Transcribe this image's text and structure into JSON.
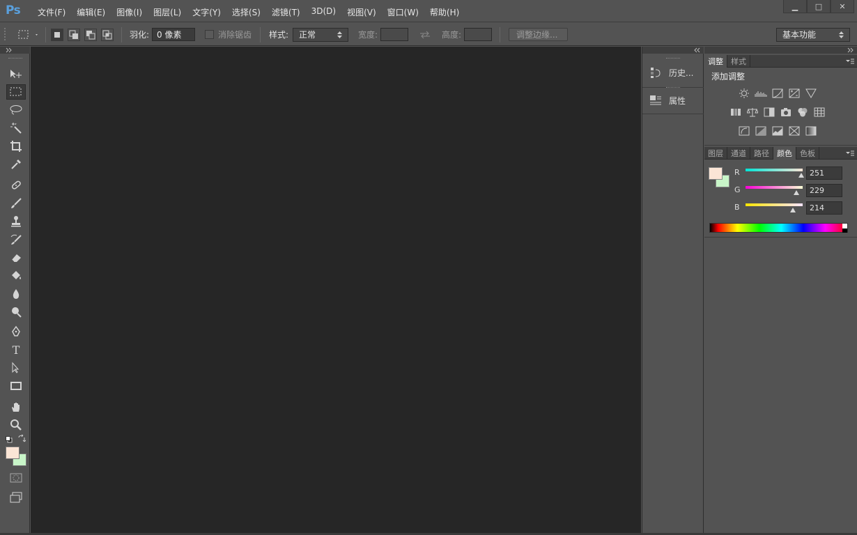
{
  "app": {
    "logo": "Ps"
  },
  "menubar": {
    "items": [
      "文件(F)",
      "编辑(E)",
      "图像(I)",
      "图层(L)",
      "文字(Y)",
      "选择(S)",
      "滤镜(T)",
      "3D(D)",
      "视图(V)",
      "窗口(W)",
      "帮助(H)"
    ]
  },
  "window_controls": {
    "minimize": "▁",
    "restore": "□",
    "close": "✕"
  },
  "options": {
    "feather_label": "羽化:",
    "feather_value": "0 像素",
    "antialias_label": "消除锯齿",
    "style_label": "样式:",
    "style_value": "正常",
    "width_label": "宽度:",
    "height_label": "高度:",
    "refine_edge_label": "调整边缘...",
    "workspace_value": "基本功能"
  },
  "middock": {
    "history_label": "历史...",
    "properties_label": "属性"
  },
  "adjustments": {
    "tabs": [
      "调整",
      "样式"
    ],
    "title": "添加调整"
  },
  "color_panel": {
    "tabs": [
      "图层",
      "通道",
      "路径",
      "颜色",
      "色板"
    ],
    "r_label": "R",
    "g_label": "G",
    "b_label": "B",
    "r_value": "251",
    "g_value": "229",
    "b_value": "214"
  },
  "colors": {
    "foreground": "#fbe5d6",
    "background": "#c8f5c8",
    "accent": "#5aa0dd"
  }
}
